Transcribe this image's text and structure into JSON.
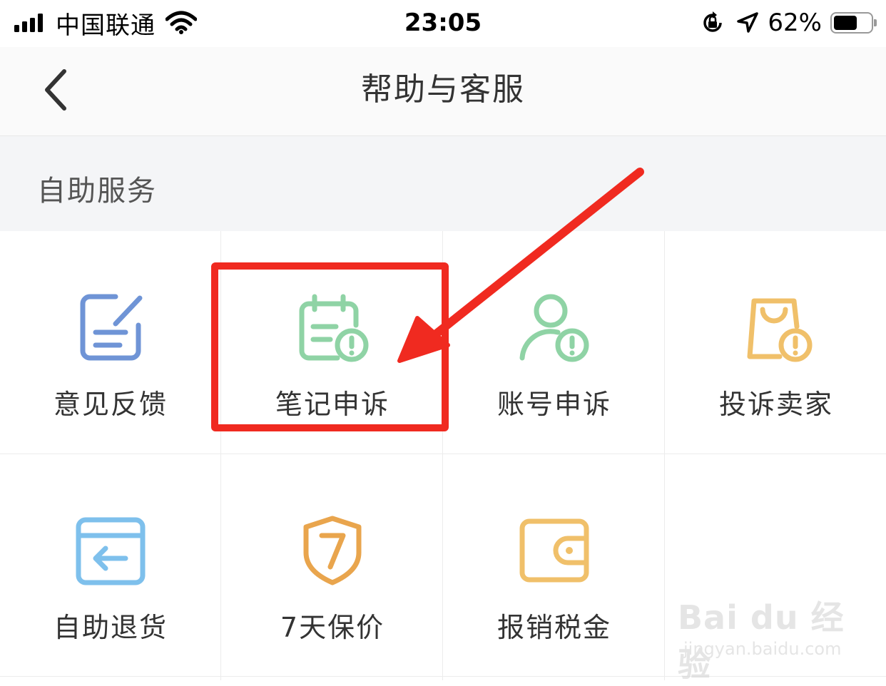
{
  "status_bar": {
    "carrier": "中国联通",
    "time": "23:05",
    "battery_percent": "62%",
    "battery_level": 0.62,
    "icons": [
      "signal-icon",
      "wifi-icon",
      "orientation-lock-icon",
      "location-icon",
      "battery-icon"
    ]
  },
  "nav": {
    "title": "帮助与客服",
    "back_icon": "chevron-left-icon"
  },
  "section": {
    "title": "自助服务"
  },
  "services": [
    {
      "label": "意见反馈",
      "icon": "feedback-icon",
      "color": "#6f94d6"
    },
    {
      "label": "笔记申诉",
      "icon": "note-appeal-icon",
      "color": "#8fd3a5"
    },
    {
      "label": "账号申诉",
      "icon": "account-appeal-icon",
      "color": "#8fd3a5"
    },
    {
      "label": "投诉卖家",
      "icon": "complain-seller-icon",
      "color": "#f0c06a"
    },
    {
      "label": "自助退货",
      "icon": "return-box-icon",
      "color": "#7ec0ec"
    },
    {
      "label": "7天保价",
      "icon": "price-protect-shield-icon",
      "color": "#e9a54d"
    },
    {
      "label": "报销税金",
      "icon": "wallet-icon",
      "color": "#f0c06a"
    }
  ],
  "annotation": {
    "highlight_color": "#f02a20"
  },
  "watermark": {
    "main": "Bai du 经验",
    "sub": "jingyan.baidu.com"
  }
}
